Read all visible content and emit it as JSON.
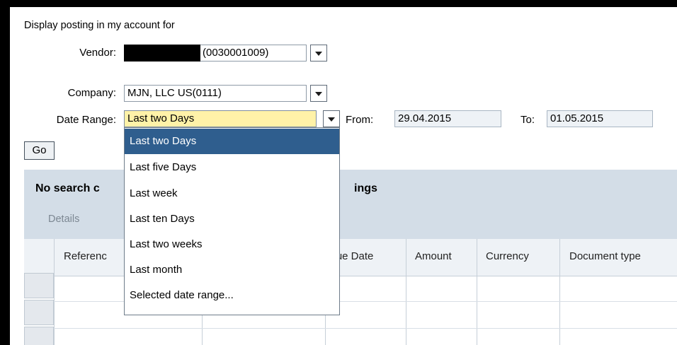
{
  "form": {
    "title": "Display posting in my account for",
    "vendor": {
      "label": "Vendor:",
      "value": "(0030001009)"
    },
    "company": {
      "label": "Company:",
      "value": "MJN, LLC US(0111)"
    },
    "date_range": {
      "label": "Date Range:",
      "value": "Last two Days",
      "from_label": "From:",
      "from_value": "29.04.2015",
      "to_label": "To:",
      "to_value": "01.05.2015"
    },
    "go_label": "Go"
  },
  "results": {
    "title_left": "No search c",
    "title_right": "ings",
    "details_label": "Details",
    "columns": [
      "Referenc",
      "Due Date",
      "Amount",
      "Currency",
      "Document type"
    ]
  },
  "dropdown": {
    "options": [
      "Last two Days",
      "Last five Days",
      "Last week",
      "Last ten Days",
      "Last two weeks",
      "Last month",
      "Selected date range..."
    ],
    "selected_index": 0
  },
  "colors": {
    "panel": "#d3dde7",
    "selected_option": "#2f5e8e",
    "active_field": "#fff2a8"
  }
}
